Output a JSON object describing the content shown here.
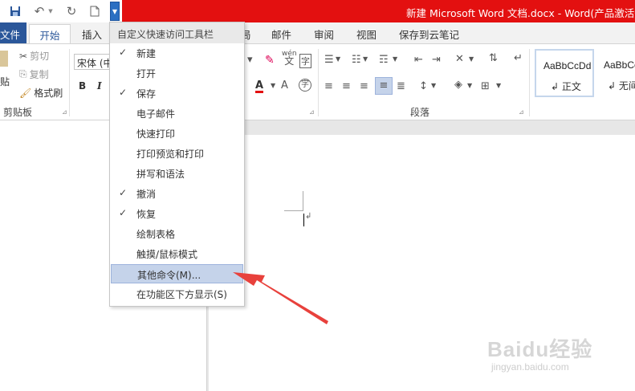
{
  "window": {
    "title": "新建 Microsoft Word 文档.docx - Word(产品激活失"
  },
  "quick_access": {
    "save_icon": "save-icon",
    "undo_icon": "undo-icon",
    "redo_icon": "redo-icon",
    "new_icon": "new-document-icon",
    "customize_icon": "customize-dropdown-icon"
  },
  "tabs": {
    "file": "文件",
    "home": "开始",
    "insert": "插入",
    "layout_partial": "局",
    "mailings": "邮件",
    "review": "审阅",
    "view": "视图",
    "save_cloud": "保存到云笔记"
  },
  "ribbon": {
    "paste_partial": "贴",
    "cut": "剪切",
    "copy": "复制",
    "format_painter": "格式刷",
    "clipboard_label": "剪贴板",
    "font_name": "宋体 (中",
    "bold": "B",
    "italic": "I",
    "wen": "wén",
    "wen_char": "文",
    "char_border": "字",
    "paragraph_label": "段落",
    "styles": [
      {
        "sample": "AaBbCcDd",
        "name": "正文"
      },
      {
        "sample": "AaBbCc",
        "name": "无间隔"
      }
    ]
  },
  "menu": {
    "header": "自定义快速访问工具栏",
    "items": [
      {
        "label": "新建",
        "checked": true
      },
      {
        "label": "打开",
        "checked": false
      },
      {
        "label": "保存",
        "checked": true
      },
      {
        "label": "电子邮件",
        "checked": false
      },
      {
        "label": "快速打印",
        "checked": false
      },
      {
        "label": "打印预览和打印",
        "checked": false
      },
      {
        "label": "拼写和语法",
        "checked": false
      },
      {
        "label": "撤消",
        "checked": true
      },
      {
        "label": "恢复",
        "checked": true
      },
      {
        "label": "绘制表格",
        "checked": false
      },
      {
        "label": "触摸/鼠标模式",
        "checked": false
      },
      {
        "label": "其他命令(M)...",
        "checked": false,
        "highlighted": true
      },
      {
        "label": "在功能区下方显示(S)",
        "checked": false
      }
    ],
    "checkmark": "✓"
  },
  "watermark": {
    "logo": "Baidu经验",
    "url": "jingyan.baidu.com"
  },
  "colors": {
    "title_bar": "#e31010",
    "word_blue": "#2b579a",
    "menu_highlight": "#c5d3ea",
    "annotation_arrow": "#e8413c"
  }
}
